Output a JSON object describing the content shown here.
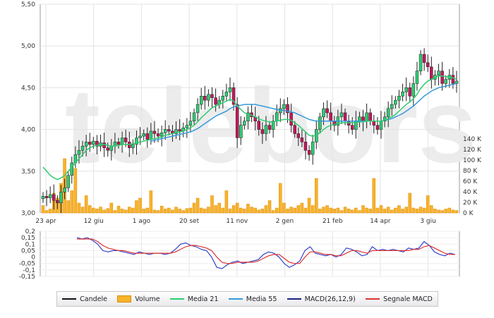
{
  "watermark": "telebors",
  "chart_data": [
    {
      "type": "candlestick",
      "title": "",
      "ylim": [
        3.0,
        5.5
      ],
      "yticks": [
        "3,00",
        "3,50",
        "4,00",
        "4,50",
        "5,00",
        "5,50"
      ],
      "xticks": [
        "23 apr",
        "12 giu",
        "1 ago",
        "20 set",
        "11 nov",
        "2 gen",
        "21 feb",
        "14 apr",
        "3 giu"
      ],
      "volume_ticks": [
        "0 K",
        "20 K",
        "40 K",
        "60 K",
        "80 K",
        "100 K",
        "120 K",
        "140 K"
      ],
      "volume_ylim": [
        0,
        150000
      ],
      "close": [
        3.2,
        3.18,
        3.22,
        3.15,
        3.12,
        3.25,
        3.3,
        3.45,
        3.6,
        3.7,
        3.75,
        3.8,
        3.85,
        3.82,
        3.86,
        3.8,
        3.84,
        3.78,
        3.75,
        3.8,
        3.85,
        3.82,
        3.9,
        3.85,
        3.78,
        3.82,
        3.9,
        3.92,
        3.95,
        3.88,
        3.98,
        3.95,
        3.92,
        3.96,
        4.0,
        3.98,
        3.95,
        4.0,
        3.98,
        4.02,
        4.05,
        4.1,
        4.2,
        4.3,
        4.4,
        4.35,
        4.42,
        4.38,
        4.3,
        4.35,
        4.4,
        4.45,
        4.5,
        4.3,
        3.9,
        4.05,
        4.1,
        4.2,
        4.15,
        4.1,
        4.0,
        3.95,
        4.05,
        4.0,
        4.1,
        4.2,
        4.25,
        4.3,
        4.2,
        4.05,
        3.95,
        3.9,
        3.85,
        3.75,
        3.7,
        3.85,
        4.0,
        4.15,
        4.25,
        4.2,
        4.1,
        4.05,
        4.15,
        4.2,
        4.1,
        4.05,
        4.0,
        4.1,
        4.15,
        4.1,
        4.2,
        4.1,
        4.05,
        4.0,
        4.1,
        4.15,
        4.25,
        4.3,
        4.35,
        4.4,
        4.45,
        4.5,
        4.4,
        4.55,
        4.7,
        4.9,
        4.8,
        4.75,
        4.6,
        4.65,
        4.7,
        4.55,
        4.6,
        4.65,
        4.55,
        4.58
      ],
      "ma21": [
        3.55,
        3.5,
        3.45,
        3.42,
        3.4,
        3.42,
        3.45,
        3.5,
        3.55,
        3.6,
        3.65,
        3.7,
        3.75,
        3.78,
        3.8,
        3.81,
        3.82,
        3.82,
        3.81,
        3.8,
        3.8,
        3.81,
        3.82,
        3.82,
        3.82,
        3.83,
        3.84,
        3.85,
        3.86,
        3.87,
        3.88,
        3.89,
        3.9,
        3.91,
        3.93,
        3.94,
        3.95,
        3.96,
        3.97,
        3.98,
        4.0,
        4.02,
        4.05,
        4.09,
        4.14,
        4.18,
        4.22,
        4.26,
        4.28,
        4.3,
        4.32,
        4.34,
        4.36,
        4.34,
        4.28,
        4.24,
        4.2,
        4.18,
        4.17,
        4.15,
        4.13,
        4.11,
        4.1,
        4.09,
        4.09,
        4.1,
        4.11,
        4.12,
        4.12,
        4.11,
        4.08,
        4.05,
        4.01,
        3.97,
        3.93,
        3.92,
        3.93,
        3.96,
        4.0,
        4.03,
        4.05,
        4.06,
        4.07,
        4.08,
        4.08,
        4.08,
        4.08,
        4.08,
        4.09,
        4.09,
        4.1,
        4.1,
        4.1,
        4.1,
        4.1,
        4.11,
        4.13,
        4.15,
        4.18,
        4.22,
        4.26,
        4.3,
        4.33,
        4.37,
        4.42,
        4.49,
        4.54,
        4.58,
        4.6,
        4.62,
        4.64,
        4.64,
        4.63,
        4.63,
        4.62,
        4.6
      ],
      "ma55": [
        null,
        null,
        null,
        null,
        null,
        null,
        null,
        null,
        null,
        null,
        null,
        null,
        null,
        null,
        null,
        null,
        null,
        null,
        null,
        null,
        null,
        null,
        null,
        null,
        null,
        null,
        null,
        null,
        null,
        null,
        3.86,
        3.87,
        3.88,
        3.89,
        3.9,
        3.91,
        3.92,
        3.93,
        3.94,
        3.95,
        3.96,
        3.97,
        3.99,
        4.01,
        4.04,
        4.07,
        4.1,
        4.13,
        4.16,
        4.18,
        4.2,
        4.22,
        4.25,
        4.27,
        4.28,
        4.29,
        4.3,
        4.3,
        4.3,
        4.3,
        4.29,
        4.28,
        4.27,
        4.26,
        4.25,
        4.24,
        4.23,
        4.23,
        4.22,
        4.21,
        4.2,
        4.18,
        4.16,
        4.14,
        4.12,
        4.11,
        4.1,
        4.1,
        4.1,
        4.1,
        4.1,
        4.1,
        4.1,
        4.1,
        4.1,
        4.1,
        4.1,
        4.1,
        4.1,
        4.1,
        4.1,
        4.1,
        4.1,
        4.1,
        4.1,
        4.11,
        4.12,
        4.13,
        4.15,
        4.17,
        4.19,
        4.22,
        4.25,
        4.28,
        4.32,
        4.36,
        4.4,
        4.43,
        4.46,
        4.48,
        4.5,
        4.51,
        4.52,
        4.53,
        4.54,
        4.55
      ],
      "volume": [
        15000,
        5000,
        8000,
        40000,
        30000,
        60000,
        110000,
        25000,
        45000,
        90000,
        20000,
        12000,
        35000,
        15000,
        10000,
        8000,
        12000,
        6000,
        9000,
        20000,
        5000,
        14000,
        8000,
        6000,
        12000,
        10000,
        25000,
        30000,
        8000,
        10000,
        45000,
        6000,
        5000,
        14000,
        8000,
        10000,
        6000,
        12000,
        8000,
        5000,
        9000,
        10000,
        20000,
        30000,
        10000,
        8000,
        12000,
        35000,
        15000,
        20000,
        10000,
        45000,
        8000,
        15000,
        20000,
        10000,
        8000,
        18000,
        12000,
        10000,
        6000,
        8000,
        15000,
        25000,
        5000,
        10000,
        60000,
        20000,
        8000,
        12000,
        10000,
        15000,
        20000,
        10000,
        30000,
        15000,
        70000,
        8000,
        12000,
        15000,
        10000,
        8000,
        10000,
        5000,
        12000,
        8000,
        6000,
        10000,
        5000,
        15000,
        10000,
        8000,
        70000,
        10000,
        15000,
        8000,
        12000,
        6000,
        10000,
        15000,
        8000,
        12000,
        40000,
        10000,
        8000,
        12000,
        10000,
        35000,
        15000,
        8000,
        6000,
        5000,
        8000,
        10000,
        6000,
        5000
      ]
    },
    {
      "type": "line",
      "title": "",
      "ylim": [
        -0.15,
        0.2
      ],
      "yticks": [
        "0,2",
        "0,15",
        "0,1",
        "0,05",
        "0",
        "-0,05",
        "-0,1",
        "-0,15"
      ],
      "series": [
        {
          "name": "MACD(26,12,9)",
          "color": "#3344cc",
          "values": [
            0.15,
            0.14,
            0.15,
            0.13,
            0.1,
            0.05,
            0.04,
            0.05,
            0.05,
            0.04,
            0.03,
            0.02,
            0.04,
            0.03,
            0.02,
            0.03,
            0.03,
            0.02,
            0.03,
            0.06,
            0.1,
            0.11,
            0.09,
            0.08,
            0.06,
            0.05,
            0.0,
            -0.08,
            -0.09,
            -0.06,
            -0.04,
            -0.03,
            -0.05,
            -0.04,
            -0.03,
            -0.02,
            0.02,
            0.04,
            0.03,
            0.0,
            -0.05,
            -0.08,
            -0.06,
            -0.03,
            0.05,
            0.08,
            0.03,
            0.02,
            0.01,
            0.02,
            0.0,
            0.02,
            0.07,
            0.06,
            0.04,
            0.01,
            0.02,
            0.08,
            0.05,
            0.06,
            0.05,
            0.06,
            0.05,
            0.04,
            0.07,
            0.06,
            0.07,
            0.12,
            0.09,
            0.04,
            0.02,
            0.01,
            0.03,
            0.02
          ]
        },
        {
          "name": "Segnale MACD",
          "color": "#dd3333",
          "values": [
            0.14,
            0.14,
            0.14,
            0.14,
            0.12,
            0.09,
            0.07,
            0.06,
            0.05,
            0.05,
            0.04,
            0.03,
            0.03,
            0.03,
            0.03,
            0.03,
            0.03,
            0.03,
            0.03,
            0.04,
            0.06,
            0.08,
            0.09,
            0.09,
            0.08,
            0.07,
            0.05,
            0.0,
            -0.04,
            -0.05,
            -0.05,
            -0.04,
            -0.04,
            -0.04,
            -0.04,
            -0.03,
            -0.01,
            0.01,
            0.02,
            0.02,
            -0.01,
            -0.04,
            -0.05,
            -0.05,
            0.0,
            0.04,
            0.04,
            0.03,
            0.02,
            0.02,
            0.01,
            0.01,
            0.03,
            0.05,
            0.05,
            0.04,
            0.03,
            0.05,
            0.05,
            0.05,
            0.05,
            0.05,
            0.05,
            0.05,
            0.05,
            0.06,
            0.06,
            0.08,
            0.09,
            0.07,
            0.05,
            0.03,
            0.02,
            0.02
          ]
        }
      ]
    }
  ],
  "legend": [
    {
      "label": "Candele",
      "kind": "line",
      "color": "#111111"
    },
    {
      "label": "Volume",
      "kind": "box",
      "color": "#f7b32b"
    },
    {
      "label": "Media 21",
      "kind": "line",
      "color": "#2ecc71"
    },
    {
      "label": "Media 55",
      "kind": "line",
      "color": "#3399dd"
    },
    {
      "label": "MACD(26,12,9)",
      "kind": "line",
      "color": "#1a237e"
    },
    {
      "label": "Segnale MACD",
      "kind": "line",
      "color": "#dd3333"
    }
  ]
}
